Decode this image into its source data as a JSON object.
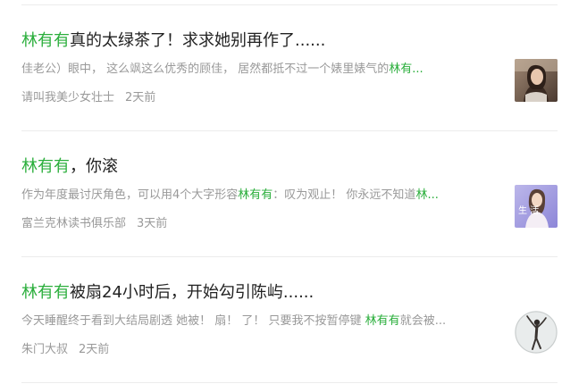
{
  "articles": [
    {
      "title_highlight": "林有有",
      "title_rest": "真的太绿茶了！求求她别再作了......",
      "desc_before": "佳老公）眼中， 这么飒这么优秀的顾佳， 居然都抵不过一个婊里婊气的",
      "desc_highlight": "林有...",
      "author": "请叫我美少女壮士",
      "time": "2天前",
      "thumb_icon": "woman-portrait-photo"
    },
    {
      "title_highlight": "林有有",
      "title_rest": "，你滚",
      "desc_before": "作为年度最讨厌角色，可以用4个大字形容",
      "desc_highlight": "林有有",
      "desc_after": "：叹为观止！ 你永远不知道",
      "desc_highlight2": "林...",
      "author": "富兰克林读书俱乐部",
      "time": "3天前",
      "thumb_text": "生 活",
      "thumb_icon": "woman-lifestyle-photo"
    },
    {
      "title_highlight": "林有有",
      "title_rest": "被扇24小时后，开始勾引陈屿......",
      "desc_before": "今天睡醒终于看到大结局剧透 她被！ 扇！ 了！ 只要我不按暂停键 ",
      "desc_highlight": "林有有",
      "desc_after": "就会被...",
      "author": "朱门大叔",
      "time": "2天前",
      "thumb_icon": "dancer-avatar"
    }
  ]
}
